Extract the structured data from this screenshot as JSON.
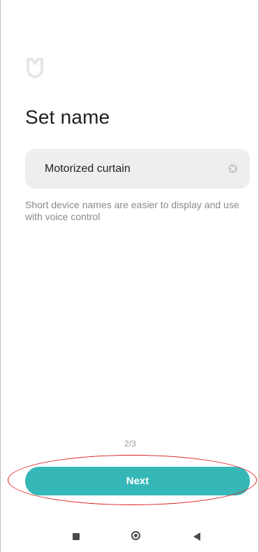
{
  "app": {
    "logo_icon": "mi-home-logo-icon",
    "accent_color": "#36b7b7",
    "highlight_color": "#e31b1b"
  },
  "page": {
    "title": "Set name",
    "name_field": {
      "value": "Motorized curtain",
      "clear_icon": "clear-icon"
    },
    "hint": "Short device names are easier to display and use with voice control",
    "step_indicator": "2/3",
    "next_label": "Next"
  },
  "nav_bar": {
    "recent_icon": "square-recents-icon",
    "home_icon": "circle-home-icon",
    "back_icon": "triangle-back-icon"
  }
}
